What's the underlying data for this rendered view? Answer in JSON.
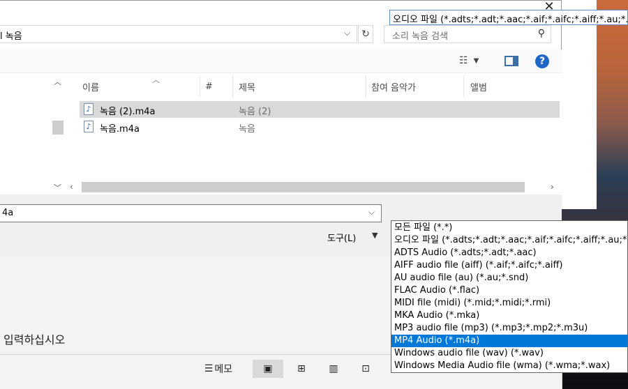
{
  "dialog": {
    "address_text": "l 녹음",
    "search_placeholder": "소리 녹음 검색",
    "columns": [
      "이름",
      "#",
      "제목",
      "참여 음악가",
      "앨범"
    ],
    "files": [
      {
        "name": "녹음 (2).m4a",
        "title": "녹음 (2)",
        "selected": true
      },
      {
        "name": "녹음.m4a",
        "title": "녹음",
        "selected": false
      }
    ],
    "filename_value": "4a",
    "filetype_value": "오디오 파일 (*.adts;*.adt;*.aac;*.aif;*.aifc;*.aiff;*.au;*.snd",
    "tools_label": "도구(L)",
    "close_glyph": "✕"
  },
  "filetype_options": [
    "모든 파일 (*.*)",
    "오디오 파일 (*.adts;*.adt;*.aac;*.aif;*.aifc;*.aiff;*.au;*.snd",
    "ADTS Audio (*.adts;*.adt;*.aac)",
    "AIFF audio file (aiff) (*.aif;*.aifc;*.aiff)",
    "AU audio file (au) (*.au;*.snd)",
    "FLAC Audio (*.flac)",
    "MIDI file (midi) (*.mid;*.midi;*.rmi)",
    "MKA Audio (*.mka)",
    "MP3 audio file (mp3) (*.mp3;*.mp2;*.m3u)",
    "MP4 Audio (*.m4a)",
    "Windows audio file (wav) (*.wav)",
    "Windows Media Audio file (wma) (*.wma;*.wax)"
  ],
  "selected_option_index": 9,
  "background_app": {
    "input_hint": "입력하십시오",
    "memo_label": "메모"
  },
  "colors": {
    "selection": "#0078d7",
    "help": "#1e66c8"
  }
}
